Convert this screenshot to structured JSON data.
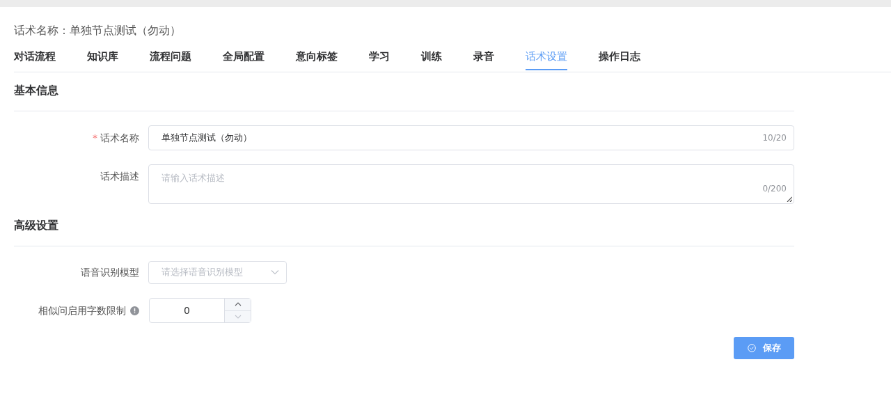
{
  "header": {
    "title": "话术名称：单独节点测试（勿动）"
  },
  "tabs": [
    {
      "label": "对话流程",
      "selected": false
    },
    {
      "label": "知识库",
      "selected": false
    },
    {
      "label": "流程问题",
      "selected": false
    },
    {
      "label": "全局配置",
      "selected": false
    },
    {
      "label": "意向标签",
      "selected": false
    },
    {
      "label": "学习",
      "selected": false
    },
    {
      "label": "训练",
      "selected": false
    },
    {
      "label": "录音",
      "selected": false
    },
    {
      "label": "话术设置",
      "selected": true
    },
    {
      "label": "操作日志",
      "selected": false
    }
  ],
  "basic_section": {
    "title": "基本信息",
    "name_field": {
      "label": "话术名称",
      "required_mark": "*",
      "value": "单独节点测试（勿动）",
      "count": "10/20"
    },
    "description_field": {
      "label": "话术描述",
      "placeholder": "请输入话术描述",
      "count": "0/200"
    }
  },
  "advanced_section": {
    "title": "高级设置",
    "model_select": {
      "label": "语音识别模型",
      "placeholder": "请选择语音识别模型"
    },
    "limit_field": {
      "label": "相似问启用字数限制",
      "value": "0",
      "decrease_disabled": true
    }
  },
  "save_button": {
    "label": "保存"
  }
}
